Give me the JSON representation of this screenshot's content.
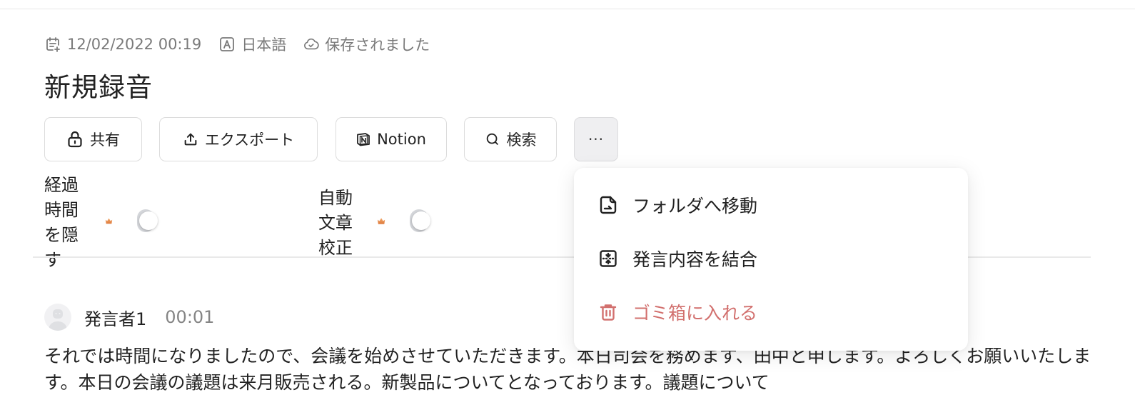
{
  "meta": {
    "date": "12/02/2022 00:19",
    "language": "日本語",
    "save_status": "保存されました"
  },
  "title": "新規録音",
  "toolbar": {
    "share_label": "共有",
    "export_label": "エクスポート",
    "notion_label": "Notion",
    "search_label": "検索",
    "more_label": "···"
  },
  "toggles": [
    {
      "label": "経過時間を隠す",
      "premium": true,
      "on": false
    },
    {
      "label": "自動文章校正",
      "premium": true,
      "on": false
    }
  ],
  "menu": {
    "items": [
      {
        "label": "フォルダへ移動",
        "icon": "move-to-folder-icon"
      },
      {
        "label": "発言内容を結合",
        "icon": "merge-icon"
      },
      {
        "label": "ゴミ箱に入れる",
        "icon": "trash-icon",
        "danger": true
      }
    ]
  },
  "transcript": {
    "speaker": "発言者1",
    "time": "00:01",
    "text": "それでは時間になりましたので、会議を始めさせていただきます。本日司会を務めます、田中と申します。よろしくお願いいたします。本日の会議の議題は来月販売される。新製品についてとなっております。議題について"
  },
  "colors": {
    "danger": "#d2706e",
    "premium_crown": "#e8894a",
    "toggle_off": "#d4d6da"
  }
}
